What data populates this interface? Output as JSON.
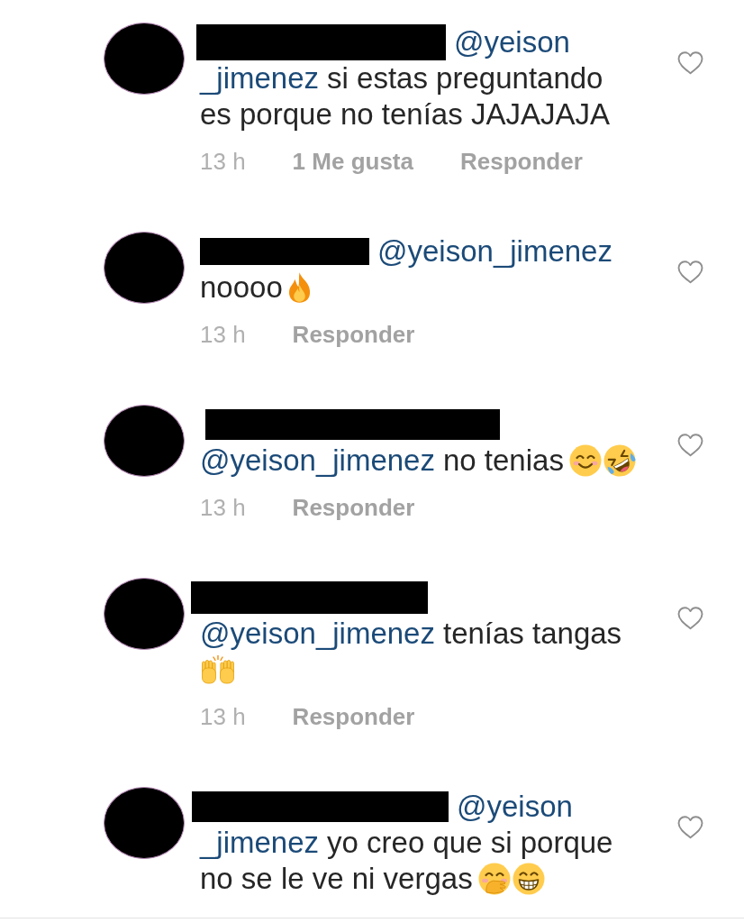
{
  "comments": [
    {
      "lines": [
        [
          {
            "kind": "redacted"
          },
          {
            "kind": "mention",
            "text": "@yeison"
          }
        ],
        [
          {
            "kind": "mention",
            "text": "_jimenez"
          },
          {
            "kind": "text",
            "text": "si estas preguntando"
          }
        ],
        [
          {
            "kind": "text",
            "text": "es porque no tenías JAJAJAJA"
          }
        ]
      ],
      "liked": false,
      "time": "13 h",
      "likes": "1 Me gusta",
      "reply": "Responder"
    },
    {
      "lines": [
        [
          {
            "kind": "redacted"
          },
          {
            "kind": "mention",
            "text": "@yeison_jimenez"
          }
        ],
        [
          {
            "kind": "text",
            "text": "noooo"
          },
          {
            "kind": "fire"
          }
        ]
      ],
      "liked": false,
      "time": "13 h",
      "reply": "Responder"
    },
    {
      "lines": [
        [
          {
            "kind": "redacted"
          }
        ],
        [
          {
            "kind": "mention",
            "text": "@yeison_jimenez"
          },
          {
            "kind": "text",
            "text": "no tenias"
          },
          {
            "kind": "smile"
          },
          {
            "kind": "rofl"
          }
        ]
      ],
      "liked": false,
      "time": "13 h",
      "reply": "Responder"
    },
    {
      "lines": [
        [
          {
            "kind": "redacted"
          }
        ],
        [
          {
            "kind": "mention",
            "text": "@yeison_jimenez"
          },
          {
            "kind": "text",
            "text": "tenías tangas"
          }
        ],
        [
          {
            "kind": "hands"
          }
        ]
      ],
      "liked": false,
      "time": "13 h",
      "reply": "Responder"
    },
    {
      "lines": [
        [
          {
            "kind": "redacted"
          },
          {
            "kind": "mention",
            "text": "@yeison"
          }
        ],
        [
          {
            "kind": "mention",
            "text": "_jimenez"
          },
          {
            "kind": "text",
            "text": "yo creo que si porque"
          }
        ],
        [
          {
            "kind": "text",
            "text": "no se le ve ni vergas"
          },
          {
            "kind": "giggle"
          },
          {
            "kind": "grin"
          }
        ]
      ],
      "liked": false
    }
  ]
}
